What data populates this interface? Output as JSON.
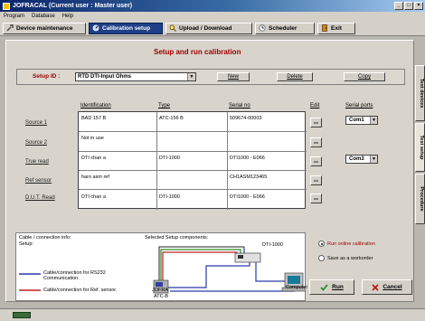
{
  "window": {
    "title": "JOFRACAL (Current user : Master user)",
    "controls": [
      "_",
      "□",
      "×"
    ]
  },
  "menu": [
    "Program",
    "Database",
    "Help"
  ],
  "toolbar": {
    "device_maintenance": "Device maintenance",
    "calibration_setup": "Calibration setup",
    "upload_download": "Upload / Download",
    "scheduler": "Scheduler",
    "exit": "Exit"
  },
  "page": {
    "heading": "Setup and run calibration",
    "setup_id_label": "Setup ID :",
    "setup_id_value": "RTD DTI-Input Ohms",
    "new_label": "New",
    "delete_label": "Delete",
    "copy_label": "Copy"
  },
  "columns": {
    "identification": "Identification",
    "type": "Type",
    "serial_no": "Serial no",
    "edit": "Edit",
    "serial_ports": "Serial ports"
  },
  "rows": [
    {
      "label": "Source 1",
      "identification": "BAD 157 B",
      "type": "ATC-156 B",
      "serial": "509674-00003",
      "port": "Com1"
    },
    {
      "label": "Source 2",
      "identification": "Not in use",
      "type": "",
      "serial": "",
      "port": ""
    },
    {
      "label": "True read",
      "identification": "DTI chan a",
      "type": "DTI-1000",
      "serial": "DTI1000 - E066",
      "port": "Com3"
    },
    {
      "label": "Ref sensor",
      "identification": "haro asm ref",
      "type": "",
      "serial": "CH1ASM123465",
      "port": ""
    },
    {
      "label": "D.U.T. Read",
      "identification": "DTI chan a",
      "type": "DTI-1000",
      "serial": "DTI1000 - E066",
      "port": ""
    }
  ],
  "side_tabs": [
    "Test devices",
    "Test setup",
    "Procedure"
  ],
  "cable": {
    "title": "Cable / connection info:",
    "subtitle": "Setup:",
    "components_label": "Selected Setup components:",
    "legend_rs232": "Cable/connection for RS232 Communication.",
    "legend_ref": "Cable/connection for Ref. sensor.",
    "device_dti": "DTI-1000",
    "device_jofra": "JOFRA",
    "device_atc": "ATC-B",
    "device_computer": "Computer",
    "colors": {
      "rs232": "#2a3aa8",
      "ref": "#c02020",
      "green": "#2a8a2a"
    }
  },
  "options": {
    "run_online": "Run online calibration",
    "save_workorder": "Save as a workorder",
    "run_label": "Run",
    "cancel_label": "Cancel"
  }
}
